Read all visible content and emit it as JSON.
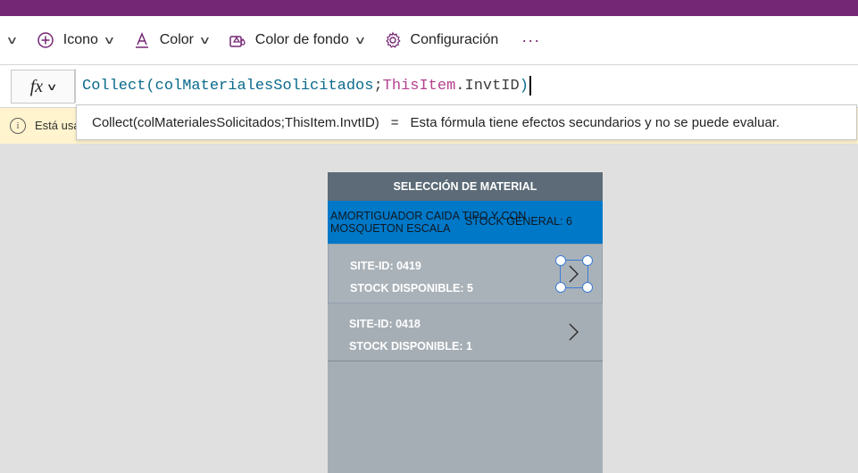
{
  "ribbon": {
    "items": [
      {
        "label": "Icono",
        "icon": "plus-circle-icon"
      },
      {
        "label": "Color",
        "icon": "text-color-icon"
      },
      {
        "label": "Color de fondo",
        "icon": "fill-color-icon"
      },
      {
        "label": "Configuración",
        "icon": "gear-icon"
      }
    ],
    "more": "···"
  },
  "formula_bar": {
    "fx_label": "fx",
    "tokens": {
      "fn": "Collect",
      "open": "(",
      "arg1": "colMaterialesSolicitados",
      "sep": ";",
      "kw": "ThisItem",
      "dot": ".",
      "prop": "InvtID",
      "close": ")"
    }
  },
  "warning": {
    "text": "Está usa"
  },
  "tooltip": {
    "formula": "Collect(colMaterialesSolicitados;ThisItem.InvtID)",
    "eq": "=",
    "message": "Esta fórmula tiene efectos secundarios y no se puede evaluar."
  },
  "screen": {
    "header": "SELECCIÓN DE MATERIAL",
    "selected": {
      "name": "AMORTIGUADOR CAIDA TIPO Y CON MOSQUETON ESCALA",
      "stock": "STOCK GENERAL: 6"
    },
    "rows": [
      {
        "site": "SITE-ID: 0419",
        "stock": "STOCK DISPONIBLE: 5"
      },
      {
        "site": "SITE-ID: 0418",
        "stock": "STOCK DISPONIBLE: 1"
      }
    ]
  },
  "colors": {
    "brand": "#742774",
    "selected_row": "#0078c8",
    "screen_header": "#5c6b77",
    "gallery_bg": "#a6aeb5",
    "warning_bg": "#fff4ce"
  }
}
